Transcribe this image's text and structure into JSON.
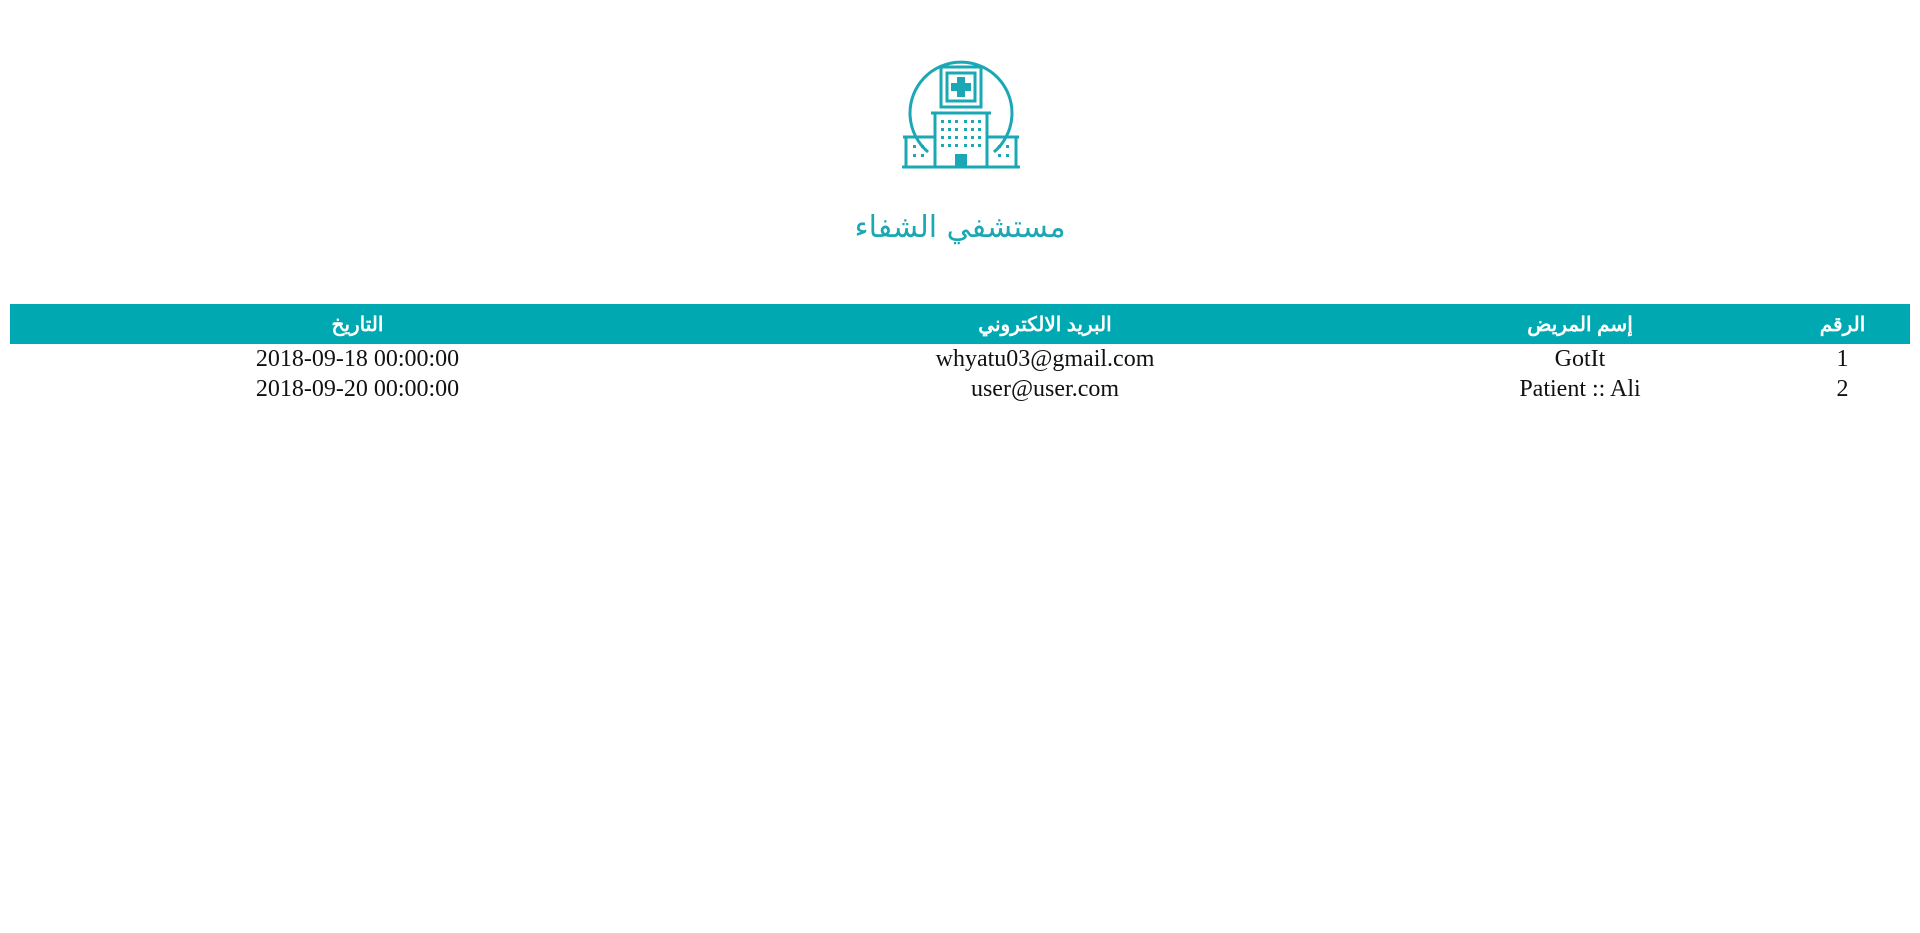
{
  "header": {
    "hospital_name": "مستشفي الشفاء",
    "logo_icon": "hospital-building-icon",
    "accent_color": "#00a8b1"
  },
  "table": {
    "columns": [
      "الرقم",
      "إسم المريض",
      "البريد الالكتروني",
      "التاريخ"
    ],
    "rows": [
      {
        "number": "1",
        "name": "GotIt",
        "email": "whyatu03@gmail.com",
        "date": "2018-09-18 00:00:00"
      },
      {
        "number": "2",
        "name": "Patient :: Ali",
        "email": "user@user.com",
        "date": "2018-09-20 00:00:00"
      }
    ]
  }
}
